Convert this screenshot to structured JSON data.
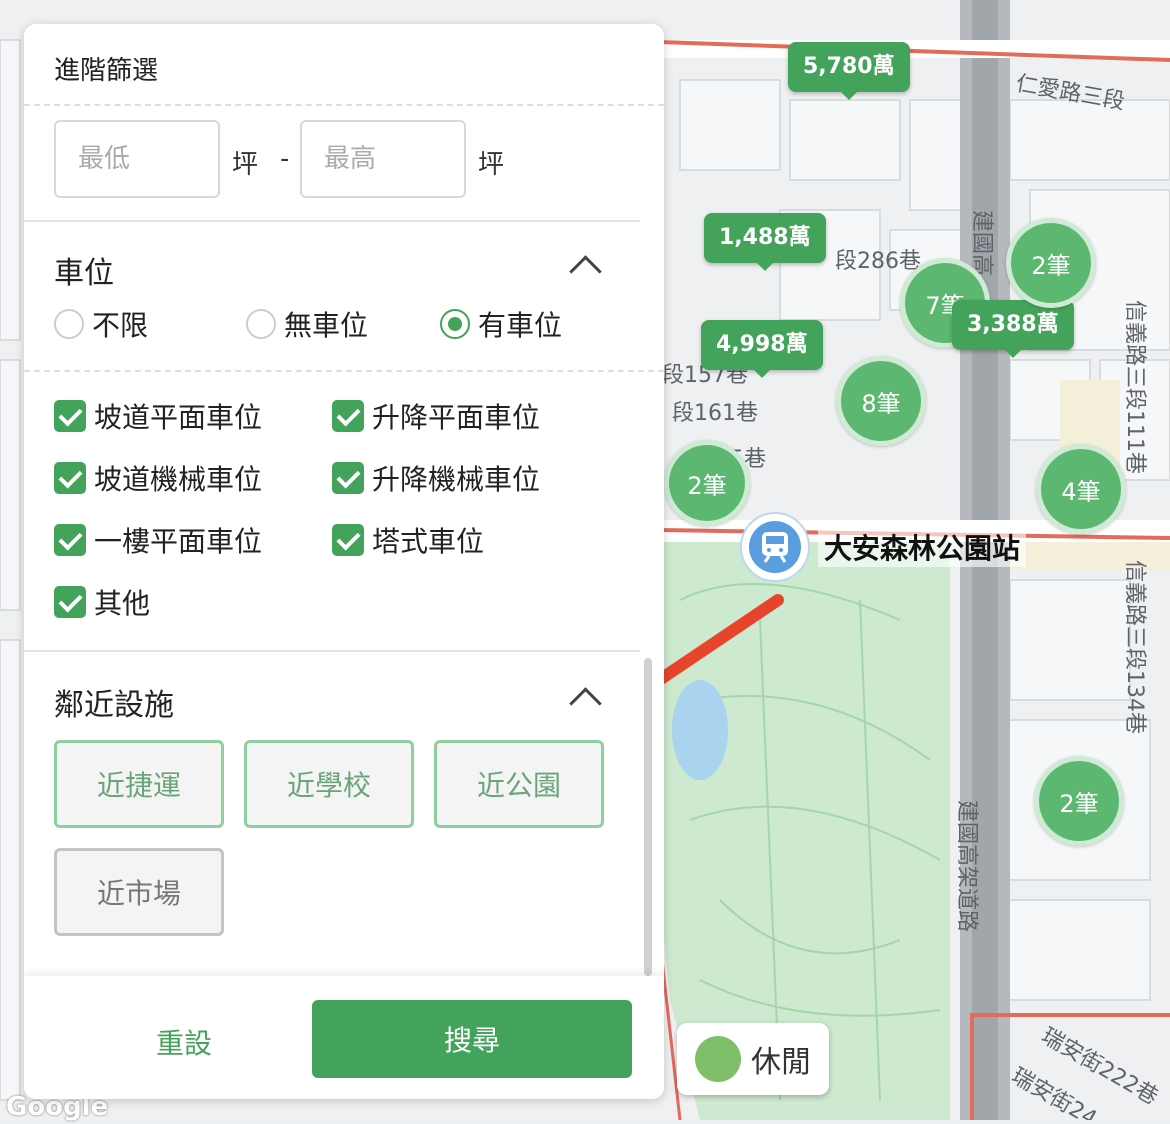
{
  "filter_panel": {
    "title": "進階篩選",
    "area": {
      "min_placeholder": "最低",
      "max_placeholder": "最高",
      "unit": "坪",
      "separator": "-"
    },
    "parking": {
      "title": "車位",
      "radio_options": [
        "不限",
        "無車位",
        "有車位"
      ],
      "selected": "有車位",
      "checkboxes": [
        {
          "label": "坡道平面車位",
          "checked": true
        },
        {
          "label": "升降平面車位",
          "checked": true
        },
        {
          "label": "坡道機械車位",
          "checked": true
        },
        {
          "label": "升降機械車位",
          "checked": true
        },
        {
          "label": "一樓平面車位",
          "checked": true
        },
        {
          "label": "塔式車位",
          "checked": true
        },
        {
          "label": "其他",
          "checked": true
        }
      ]
    },
    "facilities": {
      "title": "鄰近設施",
      "buttons": [
        "近捷運",
        "近學校",
        "近公園",
        "近市場"
      ]
    },
    "footer": {
      "reset_label": "重設",
      "search_label": "搜尋"
    }
  },
  "map": {
    "price_pins": [
      "5,780萬",
      "1,488萬",
      "4,998萬",
      "3,388萬"
    ],
    "count_clusters": [
      "2筆",
      "7筆",
      "8筆",
      "2筆",
      "4筆",
      "2筆"
    ],
    "station_name": "大安森林公園站",
    "street_labels": [
      "仁愛路三段",
      "建國南路",
      "段286巷",
      "段157巷",
      "段161巷",
      "段165巷",
      "建國高架道路",
      "信義路三段111巷",
      "信義路三段134巷",
      "瑞安街222巷",
      "瑞安街24",
      "信義路三段"
    ],
    "leisure_button": "休閒",
    "attribution": "Google",
    "colors": {
      "marker_green": "#43a35a",
      "park_green": "#c8e6c9",
      "arrow_red": "#e8432d"
    }
  }
}
